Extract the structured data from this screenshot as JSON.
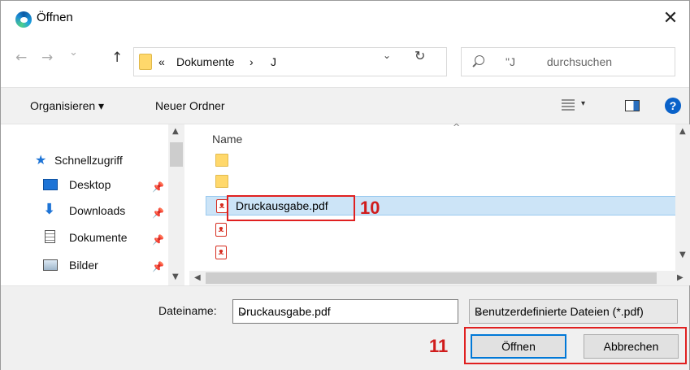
{
  "window": {
    "title": "Öffnen",
    "close_glyph": "✕"
  },
  "nav": {
    "back_glyph": "←",
    "forward_glyph": "→",
    "recent_glyph": "⌄",
    "up_glyph": "↑",
    "breadcrumb": [
      {
        "label": "«"
      },
      {
        "label": "Dokumente"
      },
      {
        "label": "›"
      },
      {
        "label": "J"
      }
    ],
    "refresh_glyph": "↻",
    "dropdown_glyph": "⌄",
    "search_placeholder": "\"J          durchsuchen"
  },
  "toolbar": {
    "organize_label": "Organisieren ▾",
    "new_folder_label": "Neuer Ordner",
    "view_caret": "▾",
    "help_label": "?"
  },
  "sidebar": {
    "items": [
      {
        "label": "Schnellzugriff",
        "icon": "star-icon",
        "pinned": false
      },
      {
        "label": "Desktop",
        "icon": "desktop-icon",
        "pinned": true
      },
      {
        "label": "Downloads",
        "icon": "download-arrow-icon",
        "pinned": true
      },
      {
        "label": "Dokumente",
        "icon": "document-icon",
        "pinned": true
      },
      {
        "label": "Bilder",
        "icon": "pictures-icon",
        "pinned": true
      }
    ],
    "pin_glyph": "📌"
  },
  "files": {
    "column_name": "Name",
    "sort_glyph": "^",
    "rows": [
      {
        "type": "folder",
        "name": ""
      },
      {
        "type": "folder",
        "name": ""
      },
      {
        "type": "pdf",
        "name": "Druckausgabe.pdf",
        "selected": true
      },
      {
        "type": "pdf",
        "name": ""
      },
      {
        "type": "pdf",
        "name": ""
      }
    ],
    "pdf_glyph": "ᴥ"
  },
  "annotations": {
    "step_10": "10",
    "step_11": "11",
    "highlight_color": "#e02020"
  },
  "footer": {
    "filename_label": "Dateiname:",
    "filename_value": "Druckausgabe.pdf",
    "filetype_value": "Benutzerdefinierte Dateien (*.pdf)",
    "open_label": "Öffnen",
    "cancel_label": "Abbrechen",
    "caret_glyph": "⌄"
  },
  "colors": {
    "accent": "#0078d7",
    "selection": "#cce4f7",
    "annotation": "#e02020"
  }
}
